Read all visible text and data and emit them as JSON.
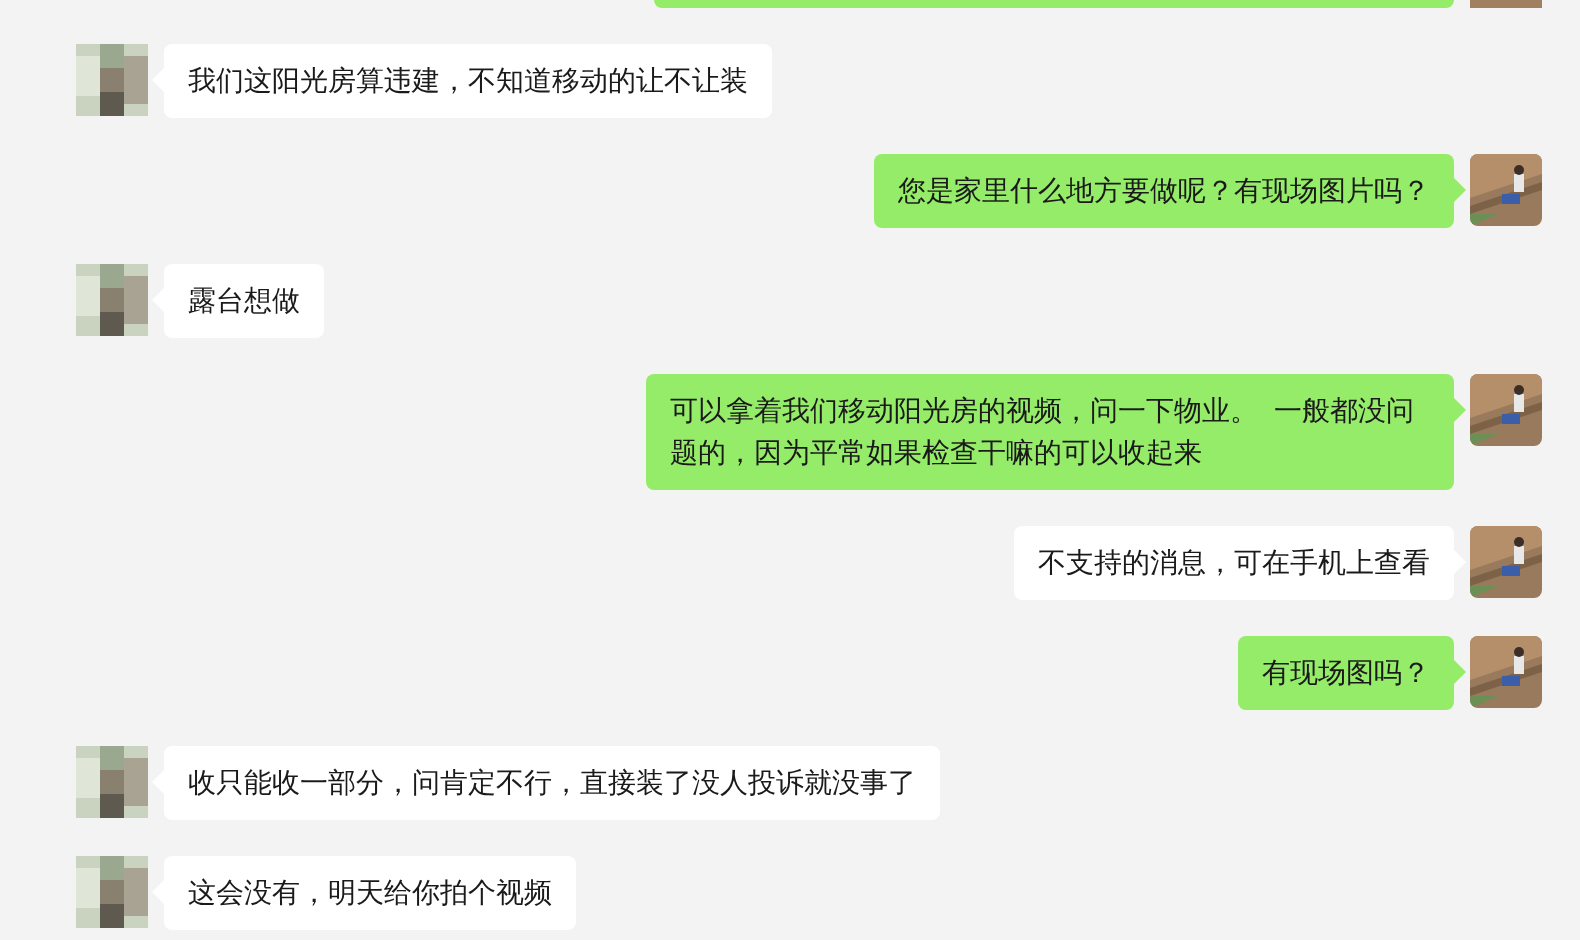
{
  "messages": [
    {
      "kind": "sent",
      "color": "#95ec69",
      "cut": true
    },
    {
      "kind": "received",
      "color": "#ffffff",
      "text": "我们这阳光房算违建，不知道移动的让不让装"
    },
    {
      "kind": "sent",
      "color": "#95ec69",
      "text": "您是家里什么地方要做呢？有现场图片吗？"
    },
    {
      "kind": "received",
      "color": "#ffffff",
      "text": "露台想做"
    },
    {
      "kind": "sent",
      "color": "#95ec69",
      "text": "可以拿着我们移动阳光房的视频，问一下物业。  一般都没问题的，因为平常如果检查干嘛的可以收起来"
    },
    {
      "kind": "sent",
      "color": "#ffffff",
      "text": "不支持的消息，可在手机上查看"
    },
    {
      "kind": "sent",
      "color": "#95ec69",
      "text": "有现场图吗？"
    },
    {
      "kind": "received",
      "color": "#ffffff",
      "text": "收只能收一部分，问肯定不行，直接装了没人投诉就没事了"
    },
    {
      "kind": "received",
      "color": "#ffffff",
      "text": "这会没有，明天给你拍个视频"
    }
  ]
}
